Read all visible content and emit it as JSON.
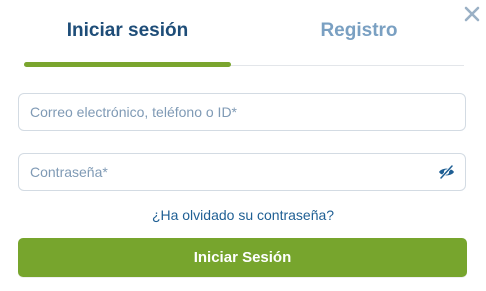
{
  "tabs": {
    "login_label": "Iniciar sesión",
    "register_label": "Registro"
  },
  "form": {
    "email_placeholder": "Correo electrónico, teléfono o ID*",
    "password_placeholder": "Contraseña*",
    "forgot_password": "¿Ha olvidado su contraseña?",
    "submit_label": "Iniciar Sesión"
  },
  "colors": {
    "brand_navy": "#1e4d78",
    "inactive_tab": "#7aa0c2",
    "accent_green": "#77a52d",
    "link_blue": "#1f5f94"
  },
  "icons": {
    "close": "close-icon",
    "password_visibility": "eye-slash-icon"
  }
}
